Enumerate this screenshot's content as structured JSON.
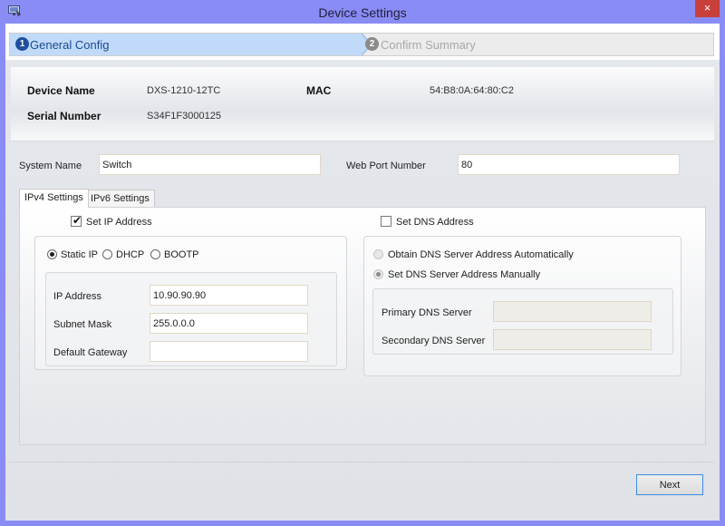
{
  "window": {
    "title": "Device Settings",
    "icon": "monitor-icon",
    "close_label": "×"
  },
  "stepper": {
    "steps": [
      {
        "number": "1",
        "label": "General Config",
        "active": true
      },
      {
        "number": "2",
        "label": "Confirm Summary",
        "active": false
      }
    ]
  },
  "device_info": {
    "device_name_label": "Device Name",
    "device_name": "DXS-1210-12TC",
    "mac_label": "MAC",
    "mac": "54:B8:0A:64:80:C2",
    "serial_label": "Serial Number",
    "serial": "S34F1F3000125"
  },
  "system": {
    "system_name_label": "System Name",
    "system_name": "Switch",
    "web_port_label": "Web Port Number",
    "web_port": "80"
  },
  "tabs": [
    {
      "label": "IPv4 Settings",
      "active": true
    },
    {
      "label": "IPv6 Settings",
      "active": false
    }
  ],
  "ipv4": {
    "set_ip": {
      "label": "Set IP Address",
      "checked": true
    },
    "mode_options": [
      {
        "label": "Static IP",
        "checked": true
      },
      {
        "label": "DHCP",
        "checked": false
      },
      {
        "label": "BOOTP",
        "checked": false
      }
    ],
    "ip_address": {
      "label": "IP Address",
      "value": "10.90.90.90"
    },
    "subnet_mask": {
      "label": "Subnet Mask",
      "value": "255.0.0.0"
    },
    "default_gateway": {
      "label": "Default Gateway",
      "value": ""
    },
    "set_dns": {
      "label": "Set DNS Address",
      "checked": false
    },
    "dns_options": [
      {
        "label": "Obtain DNS Server Address Automatically",
        "checked": false,
        "disabled": true
      },
      {
        "label": "Set DNS Server Address Manually",
        "checked": true,
        "disabled": true
      }
    ],
    "primary_dns": {
      "label": "Primary DNS Server",
      "value": ""
    },
    "secondary_dns": {
      "label": "Secondary DNS Server",
      "value": ""
    }
  },
  "footer": {
    "next_label": "Next"
  },
  "colors": {
    "title_bar": "#8a8cf5",
    "close_button": "#c7403a",
    "active_step": "#c1daf9",
    "step_badge": "#1f4f9c",
    "next_button_border": "#3c8ee0"
  }
}
